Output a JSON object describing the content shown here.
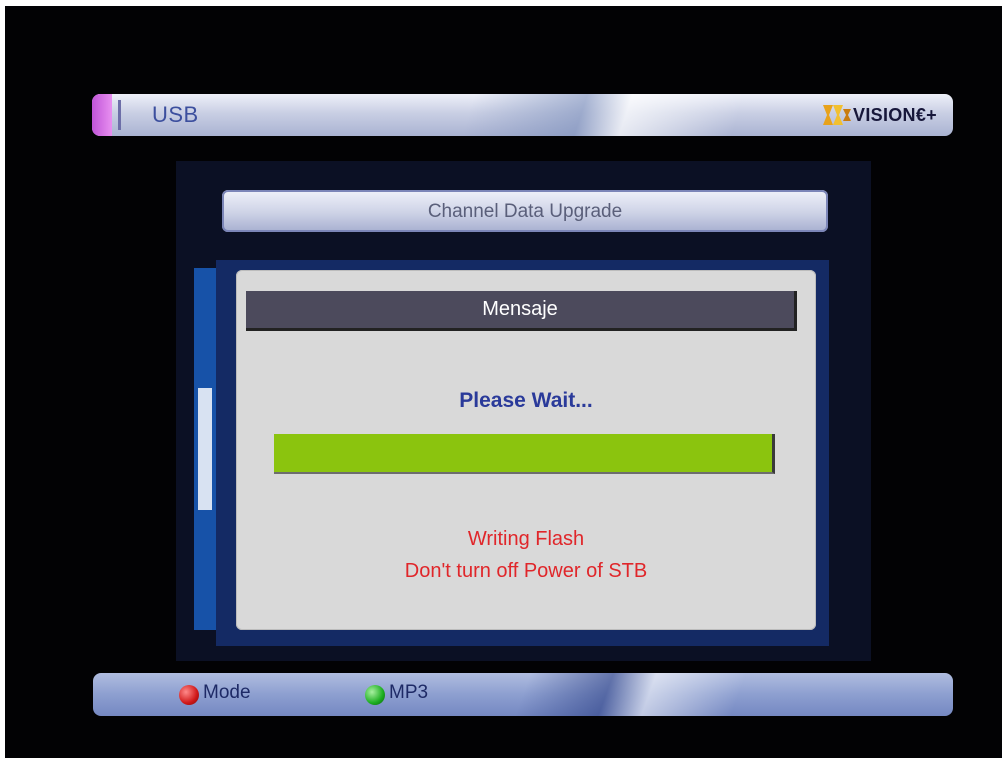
{
  "header": {
    "title": "USB",
    "logo_text": "VISION",
    "logo_suffix": "€+"
  },
  "screen": {
    "subtitle": "Channel Data Upgrade"
  },
  "dialog": {
    "title": "Mensaje",
    "message": "Please Wait...",
    "progress_percent": 100,
    "status_line_1": "Writing Flash",
    "status_line_2": "Don't turn off Power of STB"
  },
  "footer": {
    "hints": [
      {
        "color": "red",
        "label": "Mode"
      },
      {
        "color": "green",
        "label": "MP3"
      }
    ]
  },
  "colors": {
    "progress_fill": "#8bc40e",
    "status_text": "#e0262a",
    "message_text": "#2a3a9a"
  }
}
